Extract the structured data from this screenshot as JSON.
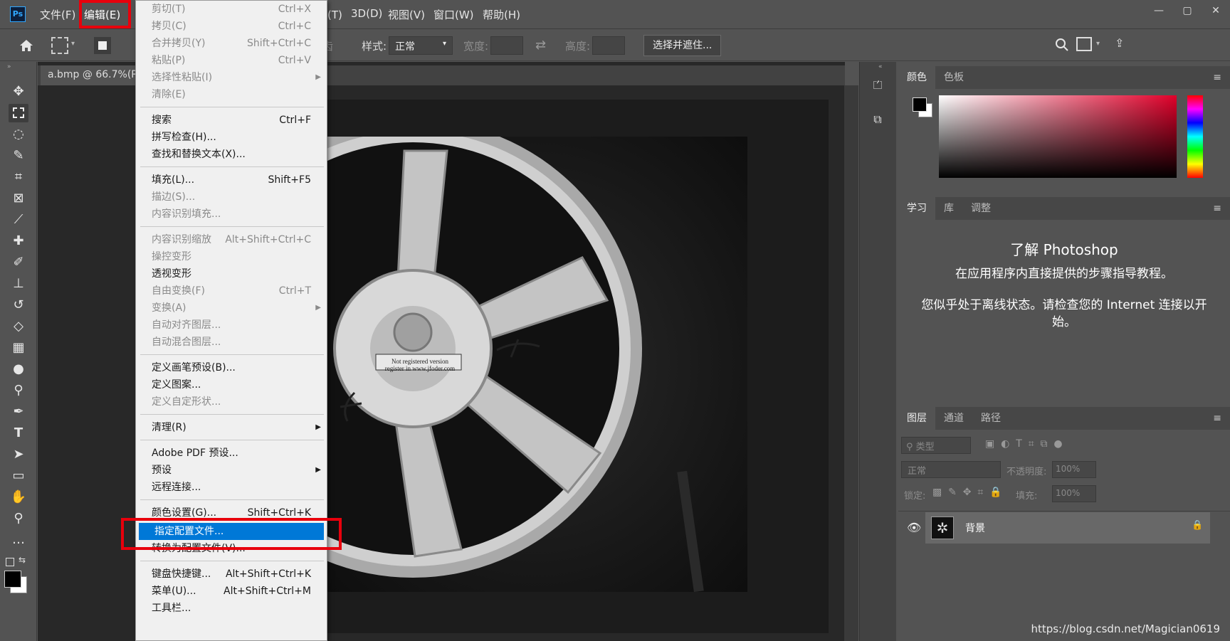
{
  "app": {
    "logo": "Ps",
    "menus": [
      "文件(F)",
      "编辑(E)",
      "滤镜(T)",
      "3D(D)",
      "视图(V)",
      "窗口(W)",
      "帮助(H)"
    ],
    "window_controls": [
      "—",
      "▢",
      "✕"
    ]
  },
  "options_bar": {
    "antialias_label": "除锯齿",
    "style_label": "样式:",
    "style_value": "正常",
    "width_label": "宽度:",
    "height_label": "高度:",
    "select_mask_button": "选择并遮住..."
  },
  "document": {
    "tab_title": "a.bmp @ 66.7%(R",
    "image_overlay_line1": "Not registered version",
    "image_overlay_line2": "register in www.jfoder.com"
  },
  "edit_menu": {
    "items": [
      {
        "label": "剪切(T)",
        "shortcut": "Ctrl+X",
        "disabled": true
      },
      {
        "label": "拷贝(C)",
        "shortcut": "Ctrl+C",
        "disabled": true
      },
      {
        "label": "合并拷贝(Y)",
        "shortcut": "Shift+Ctrl+C",
        "disabled": true
      },
      {
        "label": "粘贴(P)",
        "shortcut": "Ctrl+V",
        "disabled": true
      },
      {
        "label": "选择性粘贴(I)",
        "shortcut": "",
        "disabled": true,
        "submenu": true
      },
      {
        "label": "清除(E)",
        "shortcut": "",
        "disabled": true
      },
      {
        "label": "搜索",
        "shortcut": "Ctrl+F",
        "disabled": false
      },
      {
        "label": "拼写检查(H)...",
        "shortcut": "",
        "disabled": false
      },
      {
        "label": "查找和替换文本(X)...",
        "shortcut": "",
        "disabled": false
      },
      {
        "label": "填充(L)...",
        "shortcut": "Shift+F5",
        "disabled": false
      },
      {
        "label": "描边(S)...",
        "shortcut": "",
        "disabled": true
      },
      {
        "label": "内容识别填充...",
        "shortcut": "",
        "disabled": true
      },
      {
        "label": "内容识别缩放",
        "shortcut": "Alt+Shift+Ctrl+C",
        "disabled": true
      },
      {
        "label": "操控变形",
        "shortcut": "",
        "disabled": true
      },
      {
        "label": "透视变形",
        "shortcut": "",
        "disabled": false
      },
      {
        "label": "自由变换(F)",
        "shortcut": "Ctrl+T",
        "disabled": true
      },
      {
        "label": "变换(A)",
        "shortcut": "",
        "disabled": true,
        "submenu": true
      },
      {
        "label": "自动对齐图层...",
        "shortcut": "",
        "disabled": true
      },
      {
        "label": "自动混合图层...",
        "shortcut": "",
        "disabled": true
      },
      {
        "label": "定义画笔预设(B)...",
        "shortcut": "",
        "disabled": false
      },
      {
        "label": "定义图案...",
        "shortcut": "",
        "disabled": false
      },
      {
        "label": "定义自定形状...",
        "shortcut": "",
        "disabled": true
      },
      {
        "label": "清理(R)",
        "shortcut": "",
        "disabled": false,
        "submenu": true
      },
      {
        "label": "Adobe PDF 预设...",
        "shortcut": "",
        "disabled": false
      },
      {
        "label": "预设",
        "shortcut": "",
        "disabled": false,
        "submenu": true
      },
      {
        "label": "远程连接...",
        "shortcut": "",
        "disabled": false
      },
      {
        "label": "颜色设置(G)...",
        "shortcut": "Shift+Ctrl+K",
        "disabled": false
      },
      {
        "label": "指定配置文件...",
        "shortcut": "",
        "disabled": false,
        "highlighted": true
      },
      {
        "label": "转换为配置文件(V)...",
        "shortcut": "",
        "disabled": false
      },
      {
        "label": "键盘快捷键...",
        "shortcut": "Alt+Shift+Ctrl+K",
        "disabled": false
      },
      {
        "label": "菜单(U)...",
        "shortcut": "Alt+Shift+Ctrl+M",
        "disabled": false
      },
      {
        "label": "工具栏...",
        "shortcut": "",
        "disabled": false
      }
    ]
  },
  "color_panel": {
    "tabs": [
      "颜色",
      "色板"
    ]
  },
  "learn_panel": {
    "tabs": [
      "学习",
      "库",
      "调整"
    ],
    "title": "了解 Photoshop",
    "subtitle": "在应用程序内直接提供的步骤指导教程。",
    "offline_message": "您似乎处于离线状态。请检查您的 Internet 连接以开始。"
  },
  "layers_panel": {
    "tabs": [
      "图层",
      "通道",
      "路径"
    ],
    "filter_placeholder": "类型",
    "blend_mode": "正常",
    "opacity_label": "不透明度:",
    "opacity_value": "100%",
    "lock_label": "锁定:",
    "fill_label": "填充:",
    "fill_value": "100%",
    "layer_name": "背景"
  },
  "watermark": "https://blog.csdn.net/Magician0619",
  "colors": {
    "highlight": "#0078d7",
    "annotation_red": "#e8000c",
    "ps_blue": "#31a8ff"
  }
}
